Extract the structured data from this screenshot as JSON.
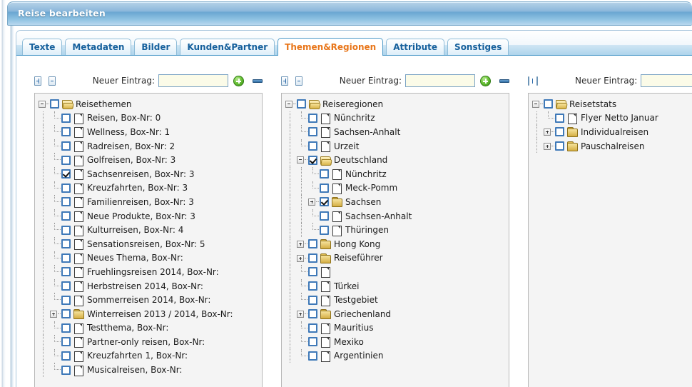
{
  "window": {
    "title": "Reise bearbeiten"
  },
  "tabs": [
    {
      "label": "Texte",
      "active": false
    },
    {
      "label": "Metadaten",
      "active": false
    },
    {
      "label": "Bilder",
      "active": false
    },
    {
      "label": "Kunden&Partner",
      "active": false
    },
    {
      "label": "Themen&Regionen",
      "active": true
    },
    {
      "label": "Attribute",
      "active": false
    },
    {
      "label": "Sonstiges",
      "active": false
    }
  ],
  "colors": {
    "accent_blue": "#16609c",
    "active_tab_text": "#e8761a",
    "titlebar_blue": "#8db9db",
    "input_bg": "#fbfbe8",
    "add_button_green": "#6dc43a",
    "panel_bg": "#f4f4f4",
    "checkbox_border": "#3f79b8"
  },
  "columns": [
    {
      "id": "themen",
      "toolbar": {
        "expand_all_label": "+",
        "collapse_all_label": "-",
        "new_entry_label": "Neuer Eintrag:",
        "new_entry_value": "",
        "new_entry_placeholder": "",
        "add_label": "+",
        "remove_label": "-"
      },
      "nodes": [
        {
          "label": "Reisethemen",
          "depth": 0,
          "icon": "folder-open",
          "expander": "minus",
          "checked": false
        },
        {
          "label": "Reisen, Box-Nr: 0",
          "depth": 1,
          "icon": "doc",
          "expander": "none",
          "checked": false
        },
        {
          "label": "Wellness, Box-Nr: 1",
          "depth": 1,
          "icon": "doc",
          "expander": "none",
          "checked": false
        },
        {
          "label": "Radreisen, Box-Nr: 2",
          "depth": 1,
          "icon": "doc",
          "expander": "none",
          "checked": false
        },
        {
          "label": "Golfreisen, Box-Nr: 3",
          "depth": 1,
          "icon": "doc",
          "expander": "none",
          "checked": false
        },
        {
          "label": "Sachsenreisen, Box-Nr: 3",
          "depth": 1,
          "icon": "doc",
          "expander": "none",
          "checked": true
        },
        {
          "label": "Kreuzfahrten, Box-Nr: 3",
          "depth": 1,
          "icon": "doc",
          "expander": "none",
          "checked": false
        },
        {
          "label": "Familienreisen, Box-Nr: 3",
          "depth": 1,
          "icon": "doc",
          "expander": "none",
          "checked": false
        },
        {
          "label": "Neue Produkte, Box-Nr: 3",
          "depth": 1,
          "icon": "doc",
          "expander": "none",
          "checked": false
        },
        {
          "label": "Kulturreisen, Box-Nr: 4",
          "depth": 1,
          "icon": "doc",
          "expander": "none",
          "checked": false
        },
        {
          "label": "Sensationsreisen, Box-Nr: 5",
          "depth": 1,
          "icon": "doc",
          "expander": "none",
          "checked": false
        },
        {
          "label": "Neues Thema, Box-Nr:",
          "depth": 1,
          "icon": "doc",
          "expander": "none",
          "checked": false
        },
        {
          "label": "Fruehlingsreisen 2014, Box-Nr:",
          "depth": 1,
          "icon": "doc",
          "expander": "none",
          "checked": false
        },
        {
          "label": "Herbstreisen 2014, Box-Nr:",
          "depth": 1,
          "icon": "doc",
          "expander": "none",
          "checked": false
        },
        {
          "label": "Sommerreisen 2014, Box-Nr:",
          "depth": 1,
          "icon": "doc",
          "expander": "none",
          "checked": false
        },
        {
          "label": "Winterreisen 2013 / 2014, Box-Nr:",
          "depth": 1,
          "icon": "folder",
          "expander": "plus",
          "checked": false
        },
        {
          "label": "Testthema, Box-Nr:",
          "depth": 1,
          "icon": "doc",
          "expander": "none",
          "checked": false
        },
        {
          "label": "Partner-only reisen, Box-Nr:",
          "depth": 1,
          "icon": "doc",
          "expander": "none",
          "checked": false
        },
        {
          "label": "Kreuzfahrten 1, Box-Nr:",
          "depth": 1,
          "icon": "doc",
          "expander": "none",
          "checked": false
        },
        {
          "label": "Musicalreisen, Box-Nr:",
          "depth": 1,
          "icon": "doc",
          "expander": "none",
          "checked": false
        }
      ]
    },
    {
      "id": "regionen",
      "toolbar": {
        "expand_all_label": "+",
        "collapse_all_label": "-",
        "new_entry_label": "Neuer Eintrag:",
        "new_entry_value": "",
        "new_entry_placeholder": "",
        "add_label": "+",
        "remove_label": "-"
      },
      "nodes": [
        {
          "label": "Reiseregionen",
          "depth": 0,
          "icon": "folder-open",
          "expander": "minus",
          "checked": false
        },
        {
          "label": "Nünchritz",
          "depth": 1,
          "icon": "doc",
          "expander": "none",
          "checked": false
        },
        {
          "label": "Sachsen-Anhalt",
          "depth": 1,
          "icon": "doc",
          "expander": "none",
          "checked": false
        },
        {
          "label": "Urzeit",
          "depth": 1,
          "icon": "doc",
          "expander": "none",
          "checked": false
        },
        {
          "label": "Deutschland",
          "depth": 1,
          "icon": "folder-open",
          "expander": "minus",
          "checked": true
        },
        {
          "label": "Nünchritz",
          "depth": 2,
          "icon": "doc",
          "expander": "none",
          "checked": false
        },
        {
          "label": "Meck-Pomm",
          "depth": 2,
          "icon": "doc",
          "expander": "none",
          "checked": false
        },
        {
          "label": "Sachsen",
          "depth": 2,
          "icon": "folder",
          "expander": "plus",
          "checked": true
        },
        {
          "label": "Sachsen-Anhalt",
          "depth": 2,
          "icon": "doc",
          "expander": "none",
          "checked": false
        },
        {
          "label": "Thüringen",
          "depth": 2,
          "icon": "doc",
          "expander": "none",
          "checked": false
        },
        {
          "label": "Hong Kong",
          "depth": 1,
          "icon": "folder",
          "expander": "plus",
          "checked": false
        },
        {
          "label": "Reiseführer",
          "depth": 1,
          "icon": "folder",
          "expander": "plus",
          "checked": false
        },
        {
          "label": "",
          "depth": 1,
          "icon": "doc",
          "expander": "none",
          "checked": false
        },
        {
          "label": "Türkei",
          "depth": 1,
          "icon": "doc",
          "expander": "none",
          "checked": false
        },
        {
          "label": "Testgebiet",
          "depth": 1,
          "icon": "doc",
          "expander": "none",
          "checked": false
        },
        {
          "label": "Griechenland",
          "depth": 1,
          "icon": "folder",
          "expander": "plus",
          "checked": false
        },
        {
          "label": "Mauritius",
          "depth": 1,
          "icon": "doc",
          "expander": "none",
          "checked": false
        },
        {
          "label": "Mexiko",
          "depth": 1,
          "icon": "doc",
          "expander": "none",
          "checked": false
        },
        {
          "label": "Argentinien",
          "depth": 1,
          "icon": "doc",
          "expander": "none",
          "checked": false
        }
      ]
    },
    {
      "id": "statistik",
      "toolbar": {
        "expand_all_label": "+",
        "collapse_all_label": "-",
        "new_entry_label": "Neuer Eintrag:",
        "new_entry_value": "",
        "new_entry_placeholder": "",
        "add_label": "+",
        "remove_label": "-"
      },
      "nodes": [
        {
          "label": "Reisetstats",
          "depth": 0,
          "icon": "folder-open",
          "expander": "minus",
          "checked": false
        },
        {
          "label": "Flyer Netto Januar",
          "depth": 1,
          "icon": "doc",
          "expander": "none",
          "checked": false
        },
        {
          "label": "Individualreisen",
          "depth": 1,
          "icon": "folder",
          "expander": "plus",
          "checked": false
        },
        {
          "label": "Pauschalreisen",
          "depth": 1,
          "icon": "folder",
          "expander": "plus",
          "checked": false
        }
      ]
    }
  ]
}
